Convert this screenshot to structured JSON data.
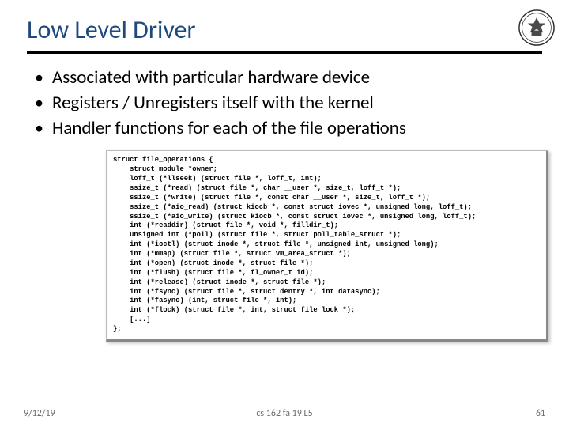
{
  "title": "Low Level Driver",
  "bullets": [
    "Associated with particular hardware device",
    "Registers / Unregisters itself with the kernel",
    "Handler functions for each of the file operations"
  ],
  "code": "struct file_operations {\n    struct module *owner;\n    loff_t (*llseek) (struct file *, loff_t, int);\n    ssize_t (*read) (struct file *, char __user *, size_t, loff_t *);\n    ssize_t (*write) (struct file *, const char __user *, size_t, loff_t *);\n    ssize_t (*aio_read) (struct kiocb *, const struct iovec *, unsigned long, loff_t);\n    ssize_t (*aio_write) (struct kiocb *, const struct iovec *, unsigned long, loff_t);\n    int (*readdir) (struct file *, void *, filldir_t);\n    unsigned int (*poll) (struct file *, struct poll_table_struct *);\n    int (*ioctl) (struct inode *, struct file *, unsigned int, unsigned long);\n    int (*mmap) (struct file *, struct vm_area_struct *);\n    int (*open) (struct inode *, struct file *);\n    int (*flush) (struct file *, fl_owner_t id);\n    int (*release) (struct inode *, struct file *);\n    int (*fsync) (struct file *, struct dentry *, int datasync);\n    int (*fasync) (int, struct file *, int);\n    int (*flock) (struct file *, int, struct file_lock *);\n    [...]\n};",
  "footer": {
    "date": "9/12/19",
    "center": "cs 162 fa 19 L5",
    "page": "61"
  }
}
